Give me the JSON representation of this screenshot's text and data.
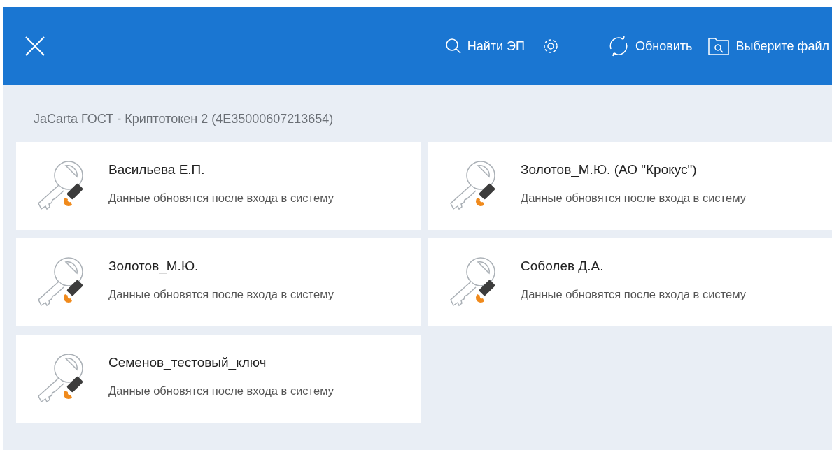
{
  "toolbar": {
    "actions": [
      {
        "kind": "search",
        "label": "Найти ЭП"
      },
      {
        "kind": "settings"
      },
      {
        "kind": "refresh",
        "label": "Обновить"
      },
      {
        "kind": "file",
        "label": "Выберите файл"
      }
    ]
  },
  "section": {
    "title": "JaCarta ГОСТ - Криптотокен 2 (4E35000607213654)"
  },
  "keys": [
    {
      "name": "Васильева Е.П.",
      "note": "Данные обновятся после входа в систему"
    },
    {
      "name": "Золотов_М.Ю. (АО \"Крокус\")",
      "note": "Данные обновятся после входа в систему"
    },
    {
      "name": "Золотов_М.Ю.",
      "note": "Данные обновятся после входа в систему"
    },
    {
      "name": "Соболев Д.А.",
      "note": "Данные обновятся после входа в систему"
    },
    {
      "name": "Семенов_тестовый_ключ",
      "note": "Данные обновятся после входа в систему"
    }
  ]
}
